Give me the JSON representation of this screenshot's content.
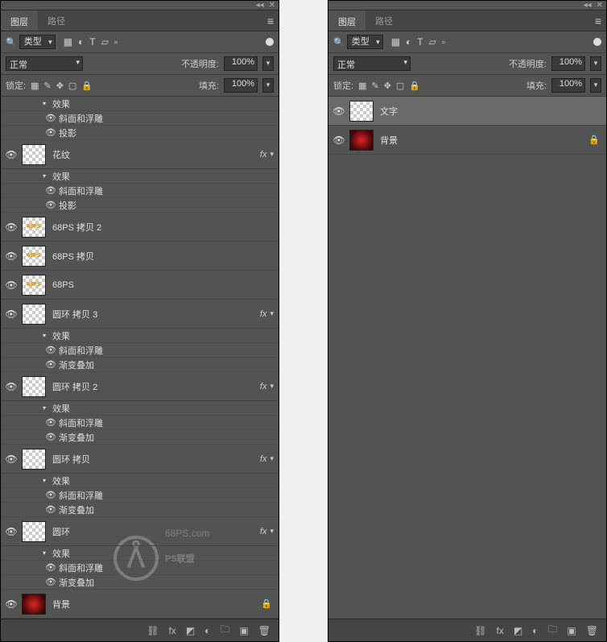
{
  "tabs": {
    "layers": "图层",
    "paths": "路径"
  },
  "filter": {
    "label": "类型"
  },
  "blend": {
    "mode": "正常",
    "opacity_label": "不透明度:",
    "opacity": "100%"
  },
  "lock": {
    "label": "锁定:",
    "fill_label": "填充:",
    "fill": "100%"
  },
  "fx_text": "fx",
  "effects": {
    "effect": "效果",
    "bevel": "斜面和浮雕",
    "shadow": "投影",
    "gradient": "渐变叠加"
  },
  "left_layers": [
    {
      "name": "效果",
      "sub_only": true
    },
    {
      "name": "花纹",
      "thumb": "checker",
      "fx": true,
      "subs": [
        "effect",
        "bevel",
        "shadow"
      ]
    },
    {
      "name": "68PS 拷贝 2",
      "thumb": "gold"
    },
    {
      "name": "68PS 拷贝",
      "thumb": "gold"
    },
    {
      "name": "68PS",
      "thumb": "gold"
    },
    {
      "name": "圆环 拷贝 3",
      "thumb": "checker",
      "fx": true,
      "subs": [
        "effect",
        "bevel",
        "gradient"
      ]
    },
    {
      "name": "圆环 拷贝 2",
      "thumb": "checker",
      "fx": true,
      "subs": [
        "effect",
        "bevel",
        "gradient"
      ]
    },
    {
      "name": "圆环 拷贝",
      "thumb": "checker",
      "fx": true,
      "subs": [
        "effect",
        "bevel",
        "gradient"
      ]
    },
    {
      "name": "圆环",
      "thumb": "checker",
      "fx": true,
      "subs": [
        "effect",
        "bevel",
        "gradient"
      ]
    },
    {
      "name": "背景",
      "thumb": "red",
      "locked": true
    }
  ],
  "right_layers": [
    {
      "name": "文字",
      "thumb": "checker",
      "selected": true
    },
    {
      "name": "背景",
      "thumb": "red",
      "locked": true
    }
  ],
  "watermark": {
    "brand": "PS联盟",
    "url": "68PS.com"
  }
}
